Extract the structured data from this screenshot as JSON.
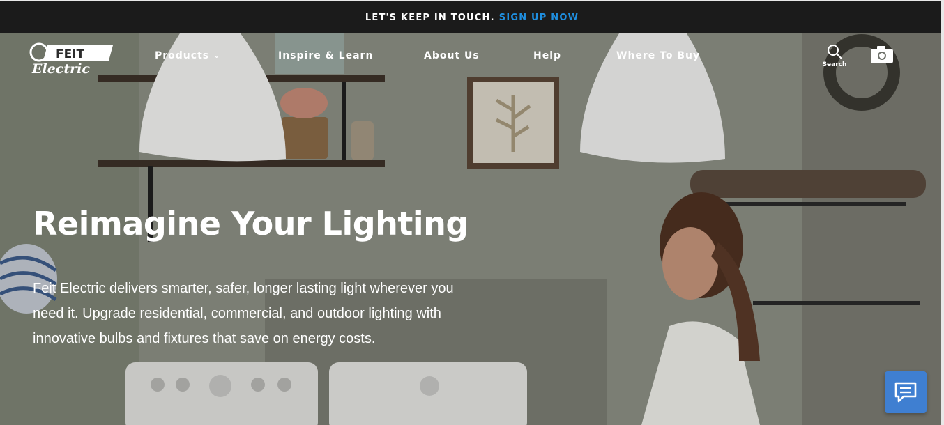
{
  "promo": {
    "text": "LET'S KEEP IN TOUCH.",
    "link": "SIGN UP NOW"
  },
  "brand": {
    "logo_line1": "FEIT",
    "logo_line2": "Electric"
  },
  "nav": {
    "items": [
      {
        "label": "Products",
        "has_dropdown": true
      },
      {
        "label": "Inspire & Learn"
      },
      {
        "label": "About Us"
      },
      {
        "label": "Help"
      },
      {
        "label": "Where To Buy"
      }
    ],
    "search_label": "Search",
    "search_icon": "search-icon",
    "camera_icon": "camera-icon"
  },
  "hero": {
    "headline": "Reimagine Your Lighting",
    "subtext": "Feit Electric delivers smarter, safer, longer lasting light wherever you need it. Upgrade residential, commercial, and outdoor lighting with innovative bulbs and fixtures that save on energy costs."
  },
  "chat": {
    "icon": "chat-icon"
  },
  "colors": {
    "promo_bg": "#1b1b1b",
    "promo_link": "#1f8fe0",
    "chat_bg": "#3f7fd1"
  }
}
